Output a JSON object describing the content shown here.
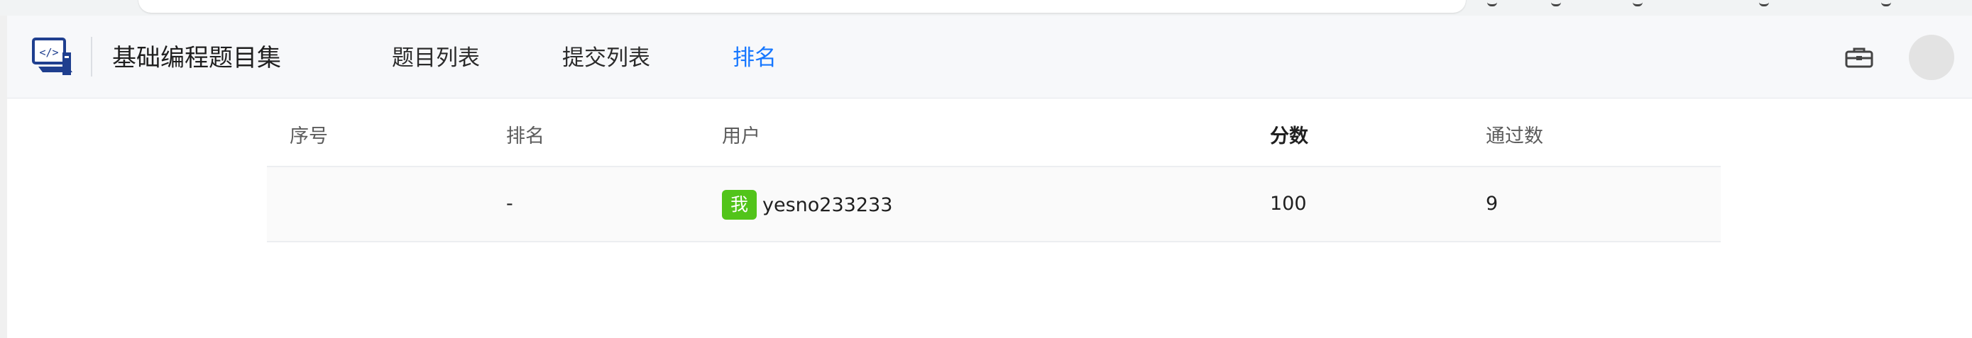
{
  "app": {
    "site_title": "基础编程题目集"
  },
  "nav": {
    "links": [
      {
        "label": "题目列表"
      },
      {
        "label": "提交列表"
      },
      {
        "label": "排名"
      }
    ],
    "active": "排名"
  },
  "icons": {
    "logo": "code-laptop-icon",
    "toolbox": "toolbox-icon",
    "avatar": "user-avatar"
  },
  "colors": {
    "accent": "#1677ff",
    "me_tag": "#52c41a",
    "nav_bg": "#f7f8fa",
    "row_bg": "#fafafa"
  },
  "table": {
    "headers": [
      "序号",
      "排名",
      "用户",
      "分数",
      "通过数"
    ],
    "rows": [
      {
        "index": "",
        "rank": "-",
        "me_tag": "我",
        "user": "yesno233233",
        "score": "100",
        "passed": "9"
      }
    ]
  }
}
